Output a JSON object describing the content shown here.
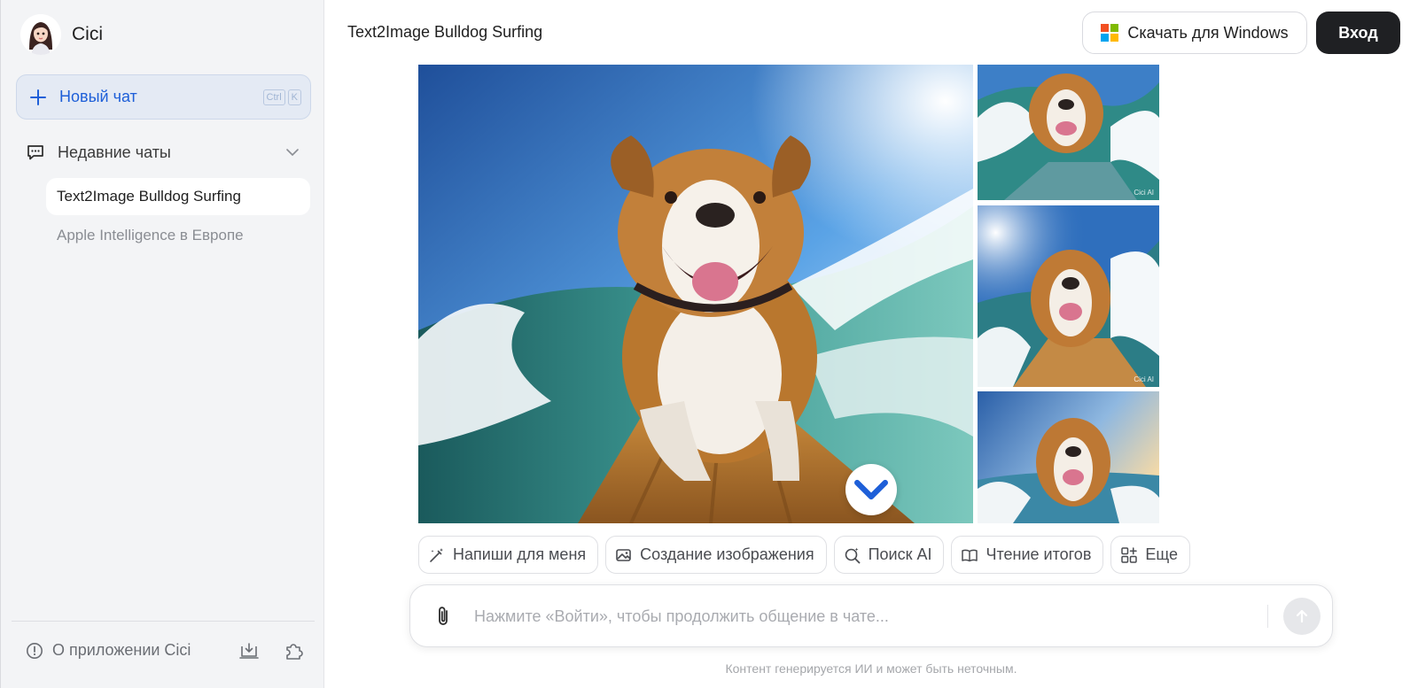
{
  "app": {
    "name": "Cici"
  },
  "sidebar": {
    "new_chat_label": "Новый чат",
    "shortcut": [
      "Ctrl",
      "K"
    ],
    "recent_label": "Недавние чаты",
    "chats": [
      {
        "label": "Text2Image Bulldog Surfing",
        "active": true
      },
      {
        "label": "Apple Intelligence в Европе",
        "active": false
      }
    ],
    "about_label": "О приложении Cici"
  },
  "header": {
    "title": "Text2Image Bulldog Surfing",
    "download_label": "Скачать для Windows",
    "login_label": "Вход"
  },
  "images": {
    "watermark": "Cici AI"
  },
  "chips": [
    {
      "label": "Напиши для меня",
      "icon": "magic-pen-icon"
    },
    {
      "label": "Создание изображения",
      "icon": "image-icon"
    },
    {
      "label": "Поиск AI",
      "icon": "search-sparkle-icon"
    },
    {
      "label": "Чтение итогов",
      "icon": "book-icon"
    },
    {
      "label": "Еще",
      "icon": "grid-plus-icon"
    }
  ],
  "composer": {
    "placeholder": "Нажмите «Войти», чтобы продолжить общение в чате..."
  },
  "footer": {
    "disclaimer": "Контент генерируется ИИ и может быть неточным."
  },
  "colors": {
    "accent": "#1e5fd8",
    "login_bg": "#1f2023",
    "sidebar_bg": "#f3f4f6"
  }
}
